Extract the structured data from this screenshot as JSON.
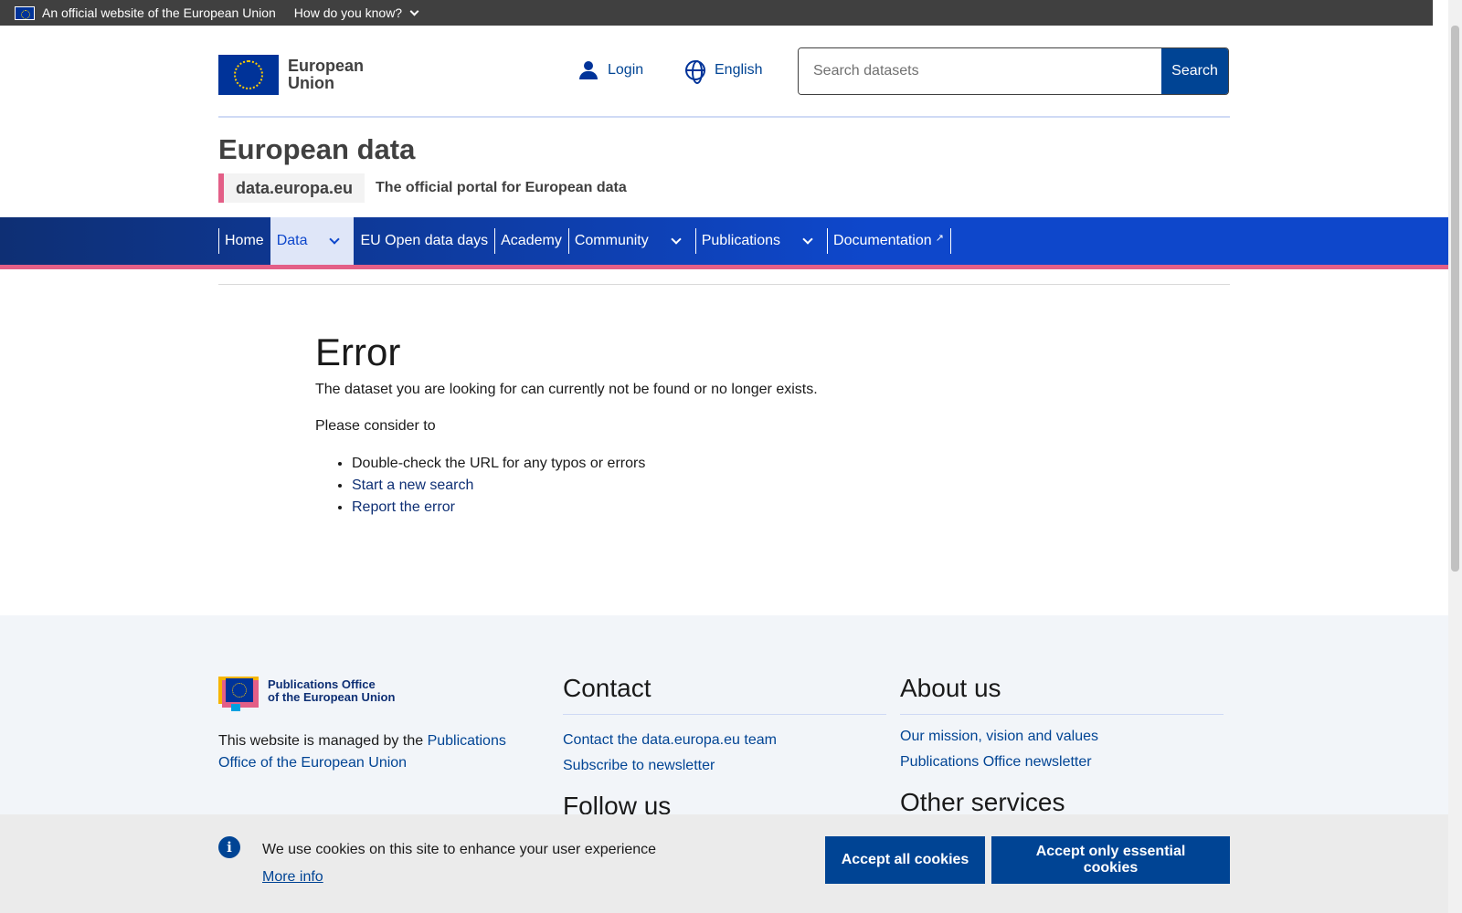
{
  "gov_banner": {
    "text": "An official website of the European Union",
    "how": "How do you know?"
  },
  "header": {
    "logo_line1": "European",
    "logo_line2": "Union",
    "login": "Login",
    "language": "English",
    "search_placeholder": "Search datasets",
    "search_button": "Search"
  },
  "site": {
    "title": "European data",
    "domain": "data.europa.eu",
    "description": "The official portal for European data"
  },
  "nav": {
    "items": [
      {
        "label": "Home",
        "dropdown": false,
        "active": false
      },
      {
        "label": "Data",
        "dropdown": true,
        "active": true
      },
      {
        "label": "EU Open data days",
        "dropdown": false,
        "active": false
      },
      {
        "label": "Academy",
        "dropdown": false,
        "active": false
      },
      {
        "label": "Community",
        "dropdown": true,
        "active": false
      },
      {
        "label": "Publications",
        "dropdown": true,
        "active": false
      },
      {
        "label": "Documentation",
        "dropdown": false,
        "active": false,
        "external": true
      }
    ]
  },
  "main": {
    "title": "Error",
    "message": "The dataset you are looking for can currently not be found or no longer exists.",
    "consider": "Please consider to",
    "suggestions": [
      {
        "text": "Double-check the URL for any typos or errors",
        "link": false
      },
      {
        "text": "Start a new search",
        "link": true
      },
      {
        "text": "Report the error",
        "link": true
      }
    ]
  },
  "footer": {
    "po_logo_line1": "Publications Office",
    "po_logo_line2": "of the European Union",
    "managed_prefix": "This website is managed by the ",
    "managed_link": "Publications Office of the European Union",
    "contact": {
      "heading": "Contact",
      "links": [
        "Contact the data.europa.eu team",
        "Subscribe to newsletter"
      ],
      "next_heading": "Follow us"
    },
    "about": {
      "heading": "About us",
      "links": [
        "Our mission, vision and values",
        "Publications Office newsletter"
      ],
      "next_heading": "Other services"
    }
  },
  "cookie": {
    "text": "We use cookies on this site to enhance your user experience",
    "more": "More info",
    "accept_all": "Accept all cookies",
    "accept_essential": "Accept only essential cookies"
  },
  "colors": {
    "primary": "#004494",
    "nav_dark": "#0e2f74",
    "nav_bright": "#0e47cb",
    "accent_pink": "#e35f87",
    "banner_bg": "#404040",
    "footer_bg": "#f2f5f9"
  },
  "icons": {
    "login": "user-icon",
    "language": "globe-icon",
    "info": "info-icon",
    "dropdown": "chevron-down-icon",
    "external": "external-link-icon"
  }
}
